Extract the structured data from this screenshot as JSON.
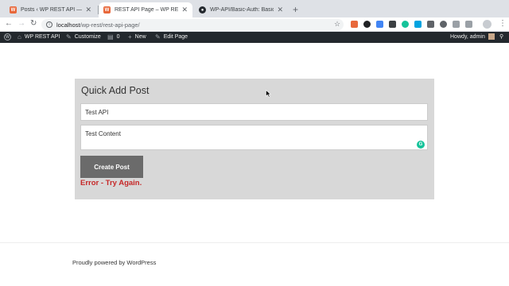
{
  "browser": {
    "tabs": [
      {
        "title": "Posts ‹ WP REST API — WordPress",
        "favicon": "wordpress-icon",
        "active": false
      },
      {
        "title": "REST API Page – WP REST API",
        "favicon": "wordpress-icon",
        "active": true
      },
      {
        "title": "WP-API/Basic-Auth: Basic Auth",
        "favicon": "github-icon",
        "active": false
      }
    ],
    "url_host": "localhost",
    "url_path": "/wp-rest/rest-api-page/"
  },
  "adminbar": {
    "site_name": "WP REST API",
    "customize": "Customize",
    "comments_count": "0",
    "new_label": "New",
    "edit_page": "Edit Page",
    "greeting": "Howdy, admin"
  },
  "form": {
    "title": "Quick Add Post",
    "title_value": "Test API",
    "content_value": "Test Content",
    "button_label": "Create Post",
    "error_text": "Error - Try Again."
  },
  "footer": {
    "text": "Proudly powered by WordPress"
  },
  "colors": {
    "error": "#c62828",
    "button": "#6b6b6b",
    "card": "#d8d8d8",
    "adminbar": "#23282d"
  }
}
